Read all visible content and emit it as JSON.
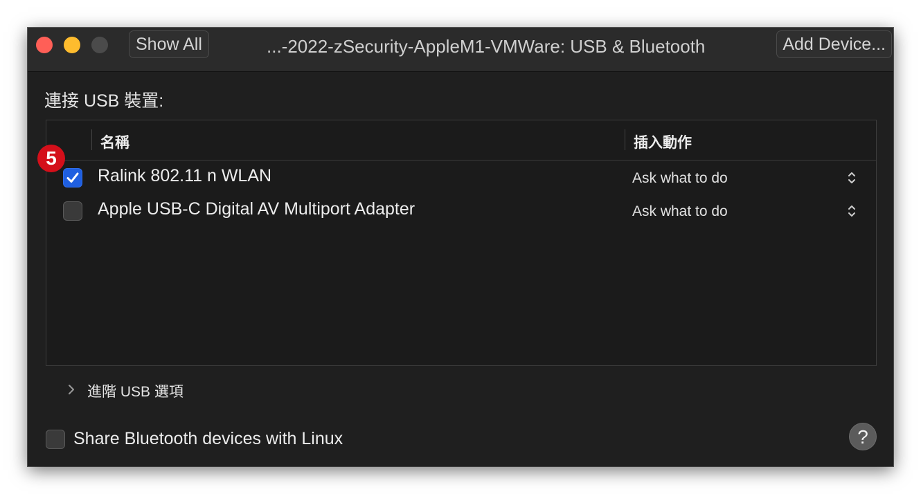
{
  "window": {
    "title": "...-2022-zSecurity-AppleM1-VMWare: USB & Bluetooth",
    "show_all_label": "Show All",
    "add_device_label": "Add Device..."
  },
  "usb": {
    "section_label": "連接 USB 裝置:",
    "columns": {
      "name": "名稱",
      "action": "插入動作"
    },
    "devices": [
      {
        "name": "Ralink 802.11 n WLAN",
        "action": "Ask what to do",
        "checked": true
      },
      {
        "name": "Apple USB-C Digital AV Multiport Adapter",
        "action": "Ask what to do",
        "checked": false
      }
    ],
    "advanced_label": "進階 USB 選項"
  },
  "annotation": {
    "step_number": "5",
    "color": "#d40f1a"
  },
  "bluetooth": {
    "share_label": "Share Bluetooth devices with Linux",
    "checked": false
  },
  "help_label": "?",
  "colors": {
    "checkbox_accent": "#1f5fe0",
    "window_bg": "#1f1f1f",
    "titlebar_bg": "#2b2b2b"
  }
}
